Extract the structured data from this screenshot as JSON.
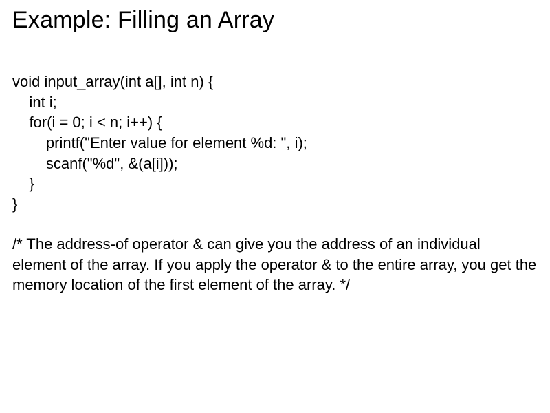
{
  "title": "Example: Filling an Array",
  "code": {
    "l1": "void input_array(int a[], int n) {",
    "l2": "    int i;",
    "l3": "    for(i = 0; i < n; i++) {",
    "l4": "        printf(\"Enter value for element %d: \", i);",
    "l5": "        scanf(\"%d\", &(a[i]));",
    "l6": "    }",
    "l7": "}"
  },
  "comment": "/* The address-of operator & can give you the address of an individual element of the array. If you apply the operator & to the entire array, you get the memory location of the first element of the array. */"
}
